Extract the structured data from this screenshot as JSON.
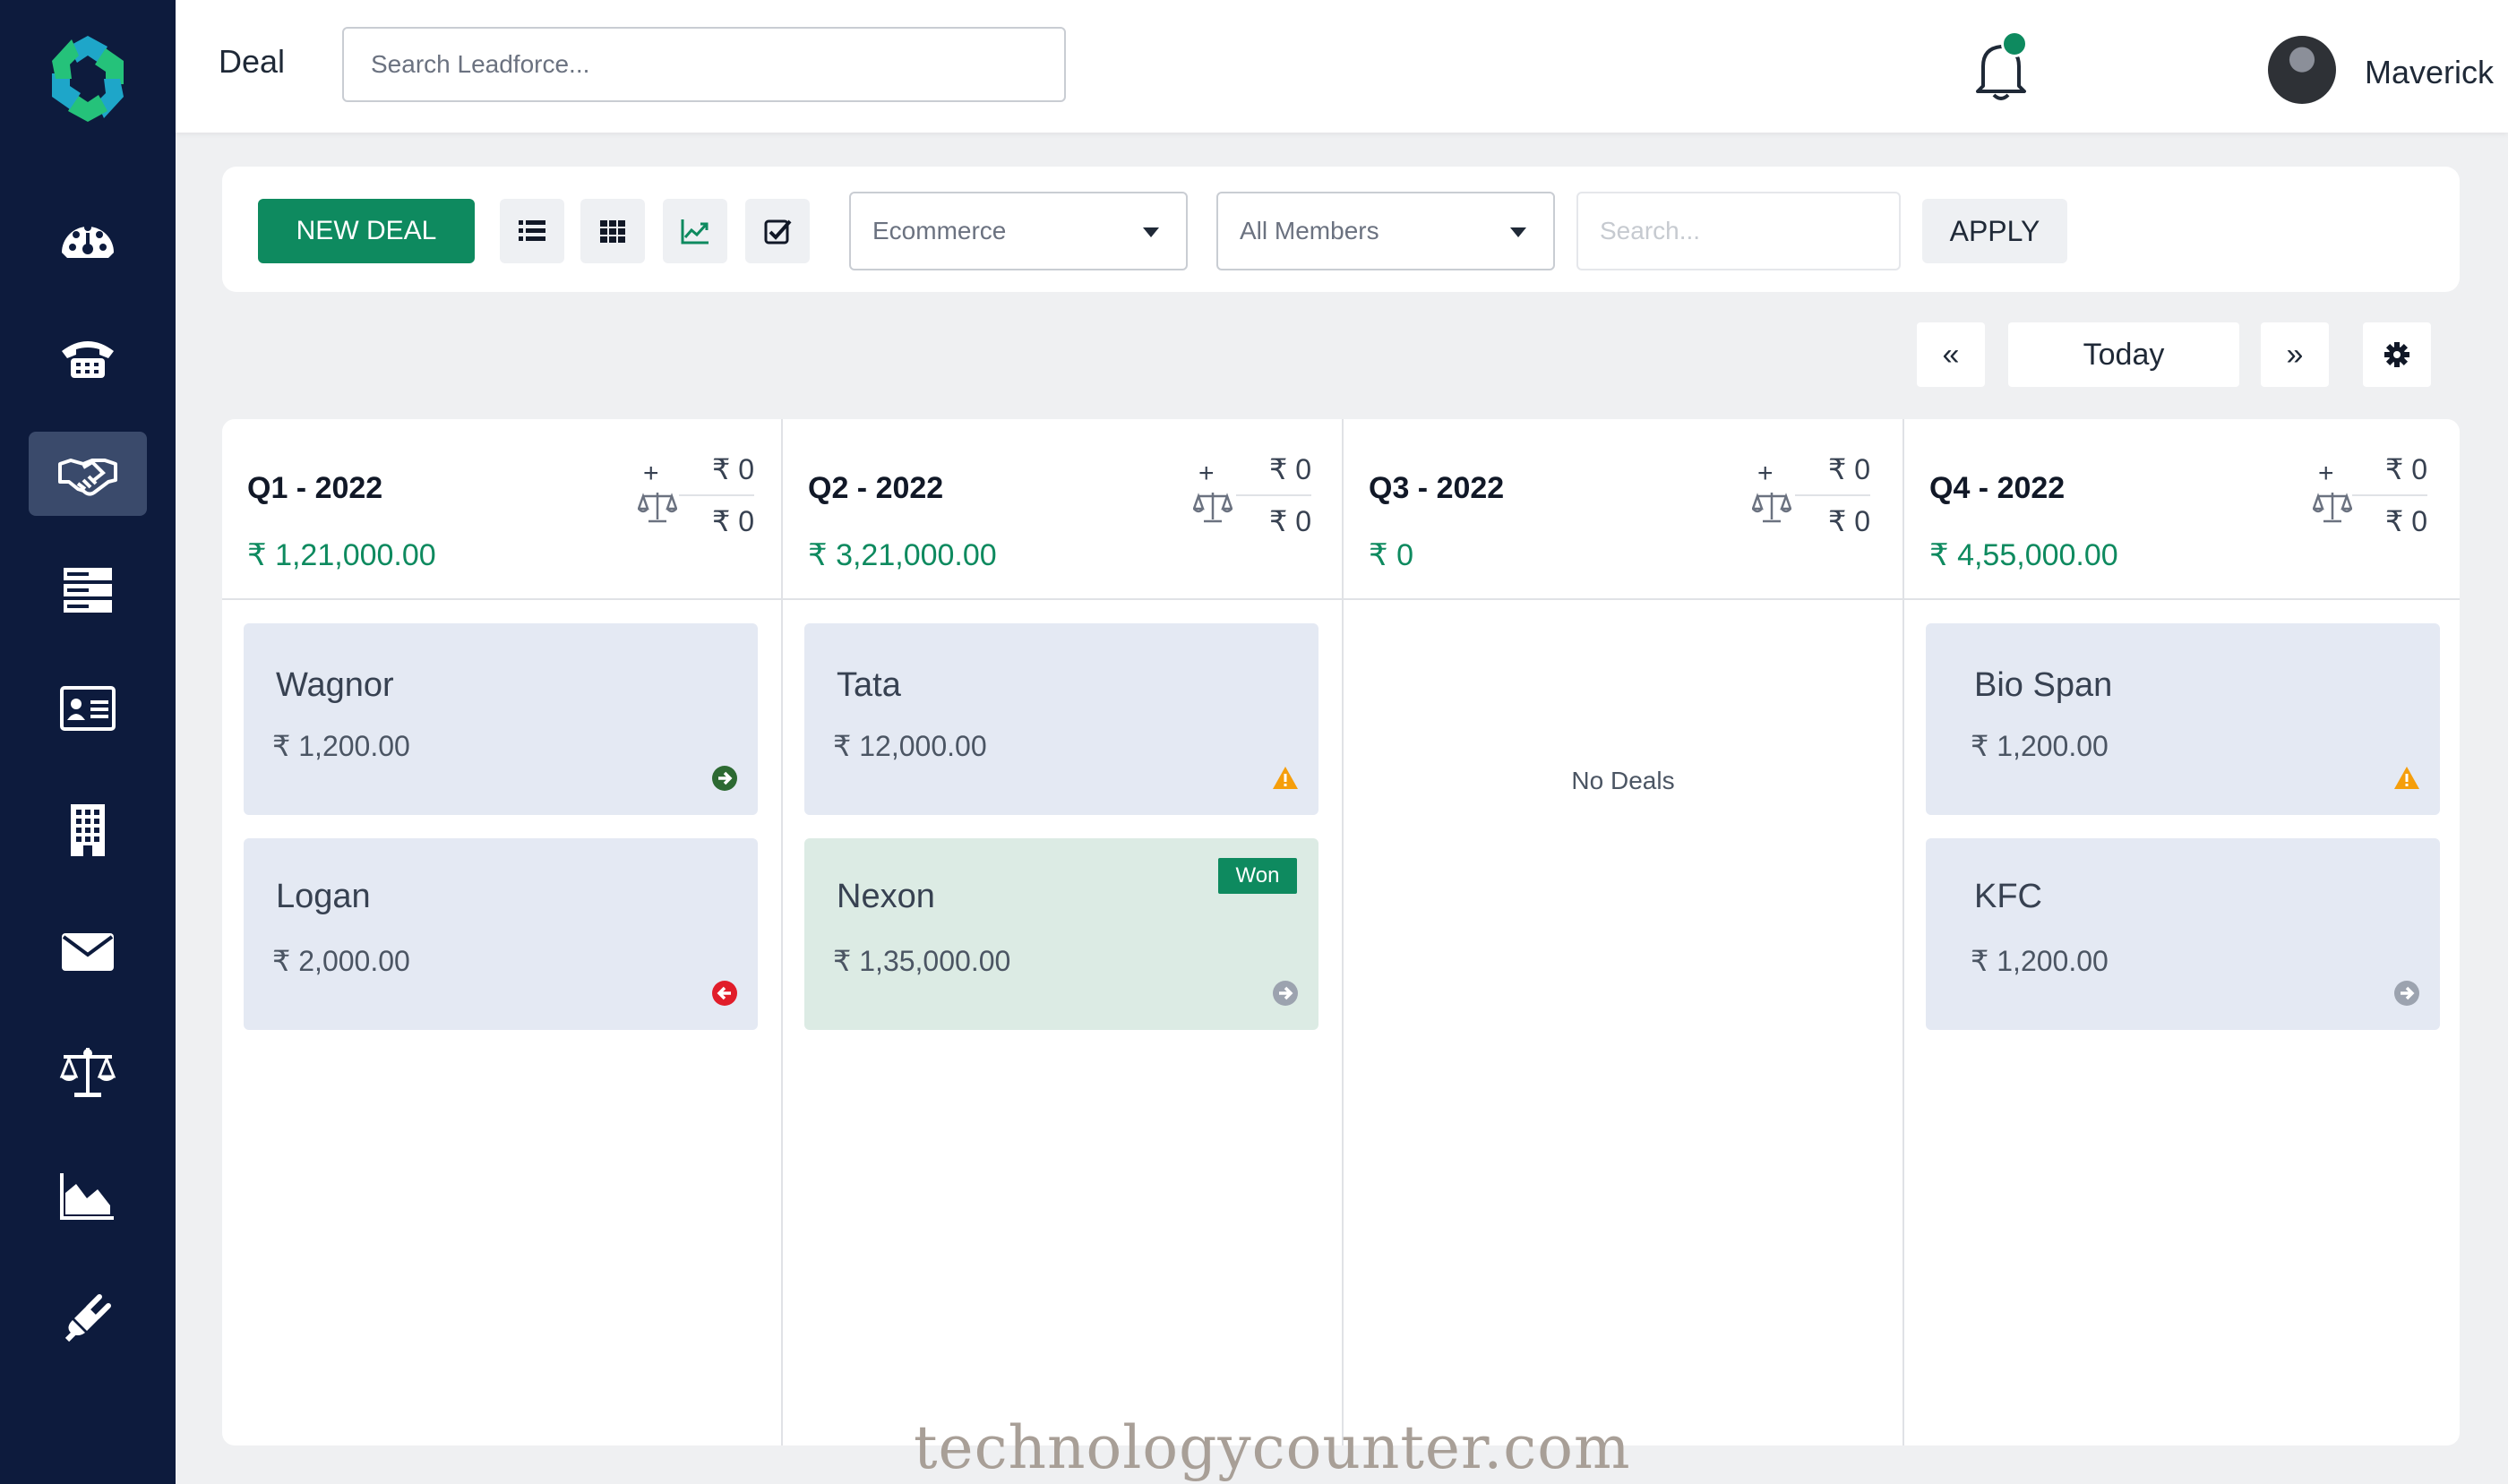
{
  "header": {
    "title": "Deal",
    "search_placeholder": "Search Leadforce...",
    "user_name": "Maverick"
  },
  "sidebar": {
    "items": [
      {
        "icon": "dashboard-icon",
        "active": false
      },
      {
        "icon": "phone-icon",
        "active": false
      },
      {
        "icon": "handshake-icon",
        "active": true
      },
      {
        "icon": "server-icon",
        "active": false
      },
      {
        "icon": "contact-card-icon",
        "active": false
      },
      {
        "icon": "building-icon",
        "active": false
      },
      {
        "icon": "mail-icon",
        "active": false
      },
      {
        "icon": "scale-icon",
        "active": false
      },
      {
        "icon": "area-chart-icon",
        "active": false
      },
      {
        "icon": "plug-icon",
        "active": false
      }
    ]
  },
  "toolbar": {
    "new_deal_label": "NEW DEAL",
    "pipeline_select": "Ecommerce",
    "members_select": "All Members",
    "search_placeholder": "Search...",
    "apply_label": "APPLY"
  },
  "period_nav": {
    "prev": "«",
    "today": "Today",
    "next": "»"
  },
  "colors": {
    "accent": "#0e8a5f",
    "sidebar": "#0d1b3d",
    "card": "#e4e9f3",
    "card_won": "#dcebe4",
    "warning": "#f59e0b",
    "lost": "#e11d2a"
  },
  "columns": [
    {
      "title": "Q1 - 2022",
      "total": "₹ 1,21,000.00",
      "plus": "+",
      "val_top": "₹ 0",
      "val_bottom": "₹ 0",
      "deals": [
        {
          "name": "Wagnor",
          "amount": "₹ 1,200.00",
          "status_icon": "arrow-right-circle-icon"
        },
        {
          "name": "Logan",
          "amount": "₹ 2,000.00",
          "status_icon": "arrow-left-circle-icon"
        }
      ]
    },
    {
      "title": "Q2 - 2022",
      "total": "₹ 3,21,000.00",
      "plus": "+",
      "val_top": "₹ 0",
      "val_bottom": "₹ 0",
      "deals": [
        {
          "name": "Tata",
          "amount": "₹ 12,000.00",
          "status_icon": "warning-icon"
        },
        {
          "name": "Nexon",
          "amount": "₹ 1,35,000.00",
          "status_icon": "arrow-right-circle-icon",
          "badge": "Won"
        }
      ]
    },
    {
      "title": "Q3 - 2022",
      "total": "₹ 0",
      "plus": "+",
      "val_top": "₹ 0",
      "val_bottom": "₹ 0",
      "deals": [],
      "empty_text": "No Deals"
    },
    {
      "title": "Q4 - 2022",
      "total": "₹ 4,55,000.00",
      "plus": "+",
      "val_top": "₹ 0",
      "val_bottom": "₹ 0",
      "deals": [
        {
          "name": "Bio Span",
          "amount": "₹ 1,200.00",
          "status_icon": "warning-icon"
        },
        {
          "name": "KFC",
          "amount": "₹ 1,200.00",
          "status_icon": "arrow-right-circle-icon"
        }
      ]
    }
  ],
  "watermark": "technologycounter.com"
}
